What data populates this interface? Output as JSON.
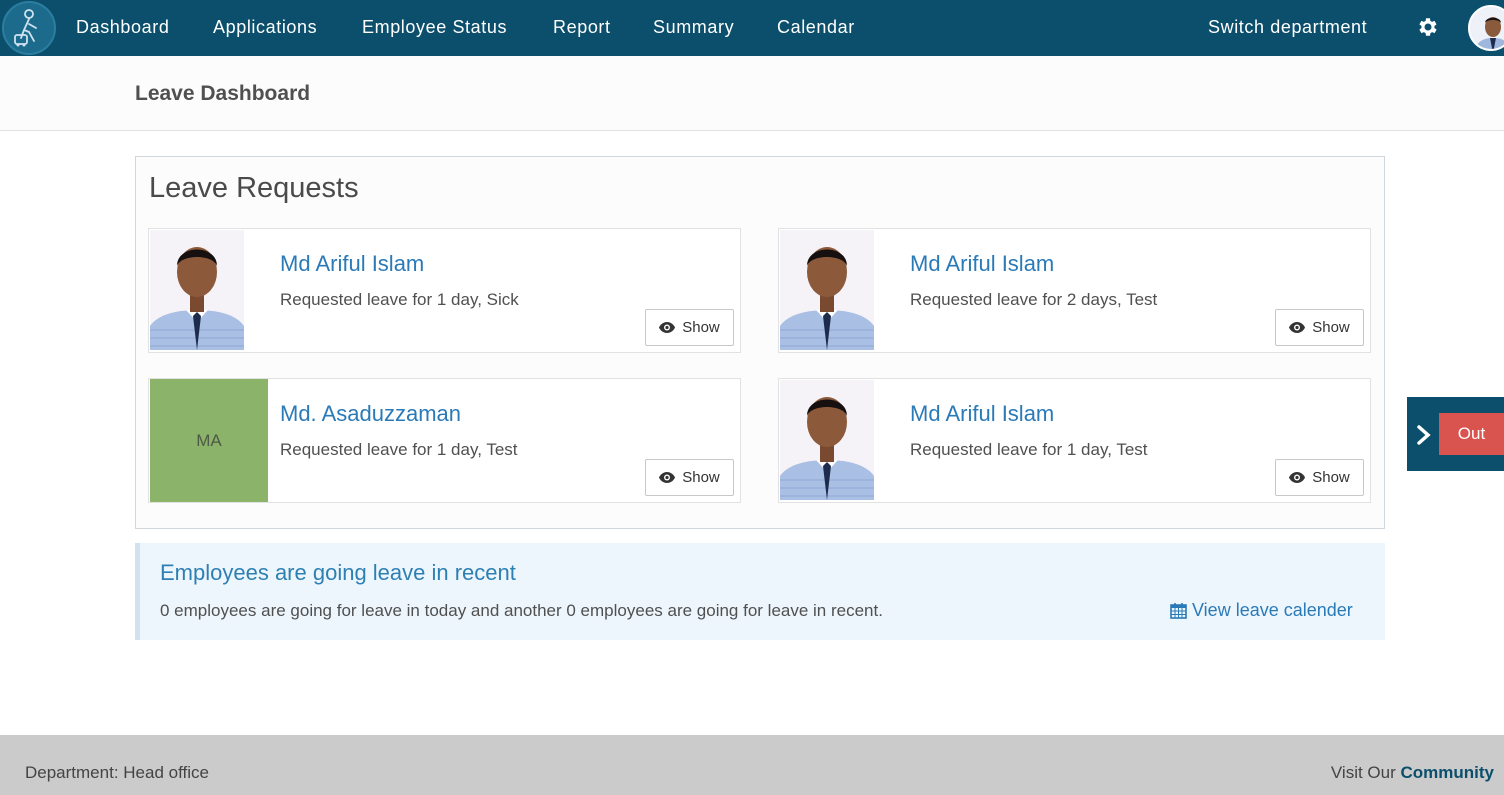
{
  "nav": {
    "items": [
      {
        "label": "Dashboard"
      },
      {
        "label": "Applications"
      },
      {
        "label": "Employee Status"
      },
      {
        "label": "Report"
      },
      {
        "label": "Summary"
      },
      {
        "label": "Calendar"
      }
    ],
    "switch_label": "Switch department",
    "settings_icon": "gear-icon"
  },
  "page": {
    "title": "Leave Dashboard"
  },
  "leave_requests": {
    "title": "Leave Requests",
    "show_label": "Show",
    "cards": [
      {
        "name": "Md Ariful Islam",
        "description": "Requested leave for 1 day, Sick",
        "avatar": "photo"
      },
      {
        "name": "Md Ariful Islam",
        "description": "Requested leave for 2 days, Test",
        "avatar": "photo"
      },
      {
        "name": "Md. Asaduzzaman",
        "description": "Requested leave for 1 day, Test",
        "avatar": "initials",
        "initials": "MA",
        "initials_bg": "#8cb36a"
      },
      {
        "name": "Md Ariful Islam",
        "description": "Requested leave for 1 day, Test",
        "avatar": "photo"
      }
    ]
  },
  "out_tab": {
    "label": "Out",
    "color": "#d9534f"
  },
  "recent_leave": {
    "title": "Employees are going leave in recent",
    "text": "0 employees are going for leave in today and another 0 employees are going for leave in recent.",
    "link_label": "View leave calender"
  },
  "footer": {
    "department": "Department: Head office",
    "visit_prefix": "Visit Our",
    "community_label": "Community"
  },
  "colors": {
    "nav_bg": "#0b4f6c",
    "link": "#2a7ab8",
    "info_bg": "#eef6fd",
    "footer_bg": "#cbcbcb"
  }
}
